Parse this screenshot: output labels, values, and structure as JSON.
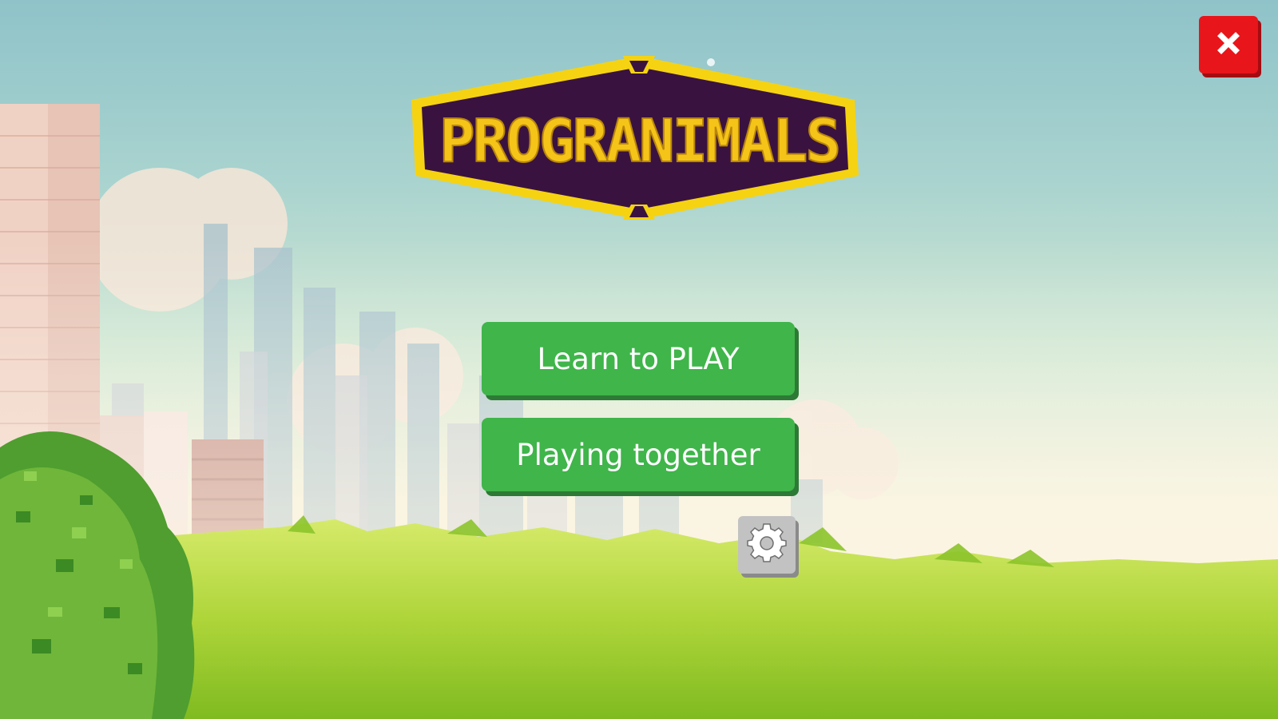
{
  "game": {
    "logo_text": "PROGRANIMALS"
  },
  "menu": {
    "learn_label": "Learn to PLAY",
    "together_label": "Playing together"
  },
  "icons": {
    "settings": "gear-icon",
    "close": "close-icon"
  },
  "colors": {
    "button_green": "#3fb54a",
    "close_red": "#e8151b",
    "logo_yellow": "#f5d312",
    "logo_purple": "#3a1240"
  }
}
